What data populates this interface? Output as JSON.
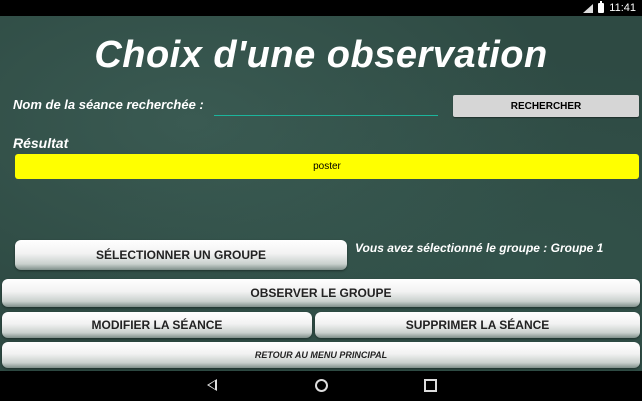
{
  "status_bar": {
    "time": "11:41",
    "icons": [
      "signal-icon",
      "battery-icon"
    ]
  },
  "header": {
    "title": "Choix d'une observation"
  },
  "search": {
    "label": "Nom de la séance recherchée :",
    "value": "",
    "button_label": "RECHERCHER"
  },
  "results": {
    "label": "Résultat",
    "items": [
      "poster"
    ],
    "highlight_color": "#ffff00"
  },
  "group": {
    "select_button_label": "SÉLECTIONNER UN GROUPE",
    "selected_text": "Vous avez sélectionné le groupe : Groupe 1"
  },
  "actions": {
    "observe_label": "OBSERVER LE GROUPE",
    "modify_label": "MODIFIER LA SÉANCE",
    "delete_label": "SUPPRIMER LA SÉANCE",
    "return_label": "RETOUR AU MENU PRINCIPAL"
  },
  "nav_bar": {
    "icons": [
      "back-icon",
      "home-icon",
      "recent-apps-icon"
    ]
  },
  "colors": {
    "board": "#2e4a43",
    "accent_underline": "#1bb59c",
    "search_button": "#d6d6d6"
  }
}
